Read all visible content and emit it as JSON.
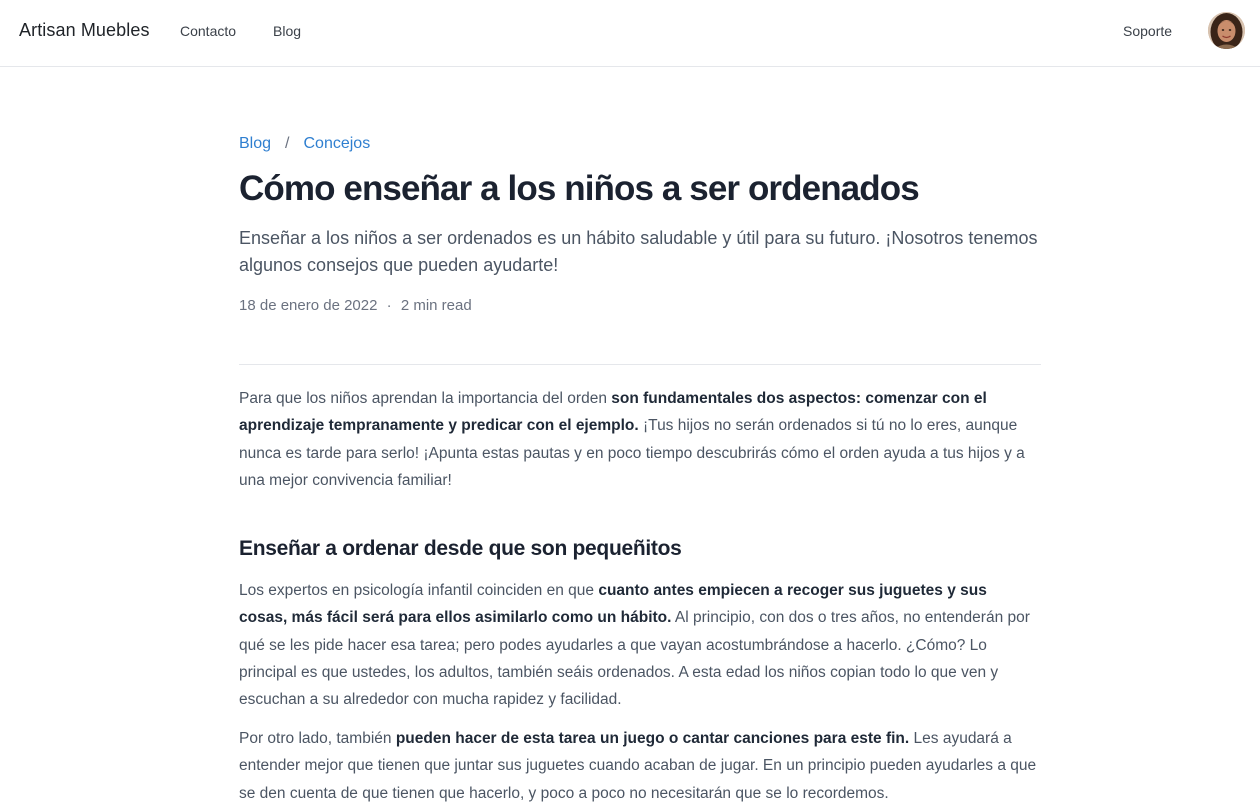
{
  "header": {
    "brand": "Artisan Muebles",
    "nav": {
      "contacto": "Contacto",
      "blog": "Blog"
    },
    "support": "Soporte"
  },
  "article": {
    "breadcrumb": {
      "root": "Blog",
      "separator": "/",
      "section": "Concejos"
    },
    "title": "Cómo enseñar a los niños a ser ordenados",
    "lead": "Enseñar a los niños a ser ordenados es un hábito saludable y útil para su futuro. ¡Nosotros tenemos algunos consejos que pueden ayudarte!",
    "date": "18 de enero de 2022",
    "meta_separator": "·",
    "read_time": "2 min read",
    "p1": {
      "before": "Para que los niños aprendan la importancia del orden ",
      "bold": "son fundamentales dos aspectos: comenzar con el aprendizaje tempranamente y predicar con el ejemplo.",
      "after": " ¡Tus hijos no serán ordenados si tú no lo eres, aunque nunca es tarde para serlo! ¡Apunta estas pautas y en poco tiempo descubrirás cómo el orden ayuda a tus hijos y a una mejor convivencia familiar!"
    },
    "heading1": "Enseñar a ordenar desde que son pequeñitos",
    "p2": {
      "before": "Los expertos en psicología infantil coinciden en que ",
      "bold": "cuanto antes empiecen a recoger sus juguetes y sus cosas, más fácil será para ellos asimilarlo como un hábito.",
      "after": " Al principio, con dos o tres años, no entenderán por qué se les pide hacer esa tarea; pero podes ayudarles a que vayan acostumbrándose a hacerlo. ¿Cómo? Lo principal es que ustedes, los adultos, también seáis ordenados. A esta edad los niños copian todo lo que ven y escuchan a su alrededor con mucha rapidez y facilidad."
    },
    "p3": {
      "before": "Por otro lado, también ",
      "bold": "pueden hacer de esta tarea un juego o cantar canciones para este fin.",
      "after": " Les ayudará a entender mejor que tienen que juntar sus juguetes cuando acaban de jugar. En un principio pueden ayudarles a que se den cuenta de que tienen que hacerlo, y poco a poco no necesitarán que se lo recordemos."
    }
  },
  "colors": {
    "link": "#2f7fd0",
    "heading": "#1b2230",
    "body_text": "#4b5563",
    "muted": "#6b7280",
    "divider": "#e5e7eb"
  }
}
